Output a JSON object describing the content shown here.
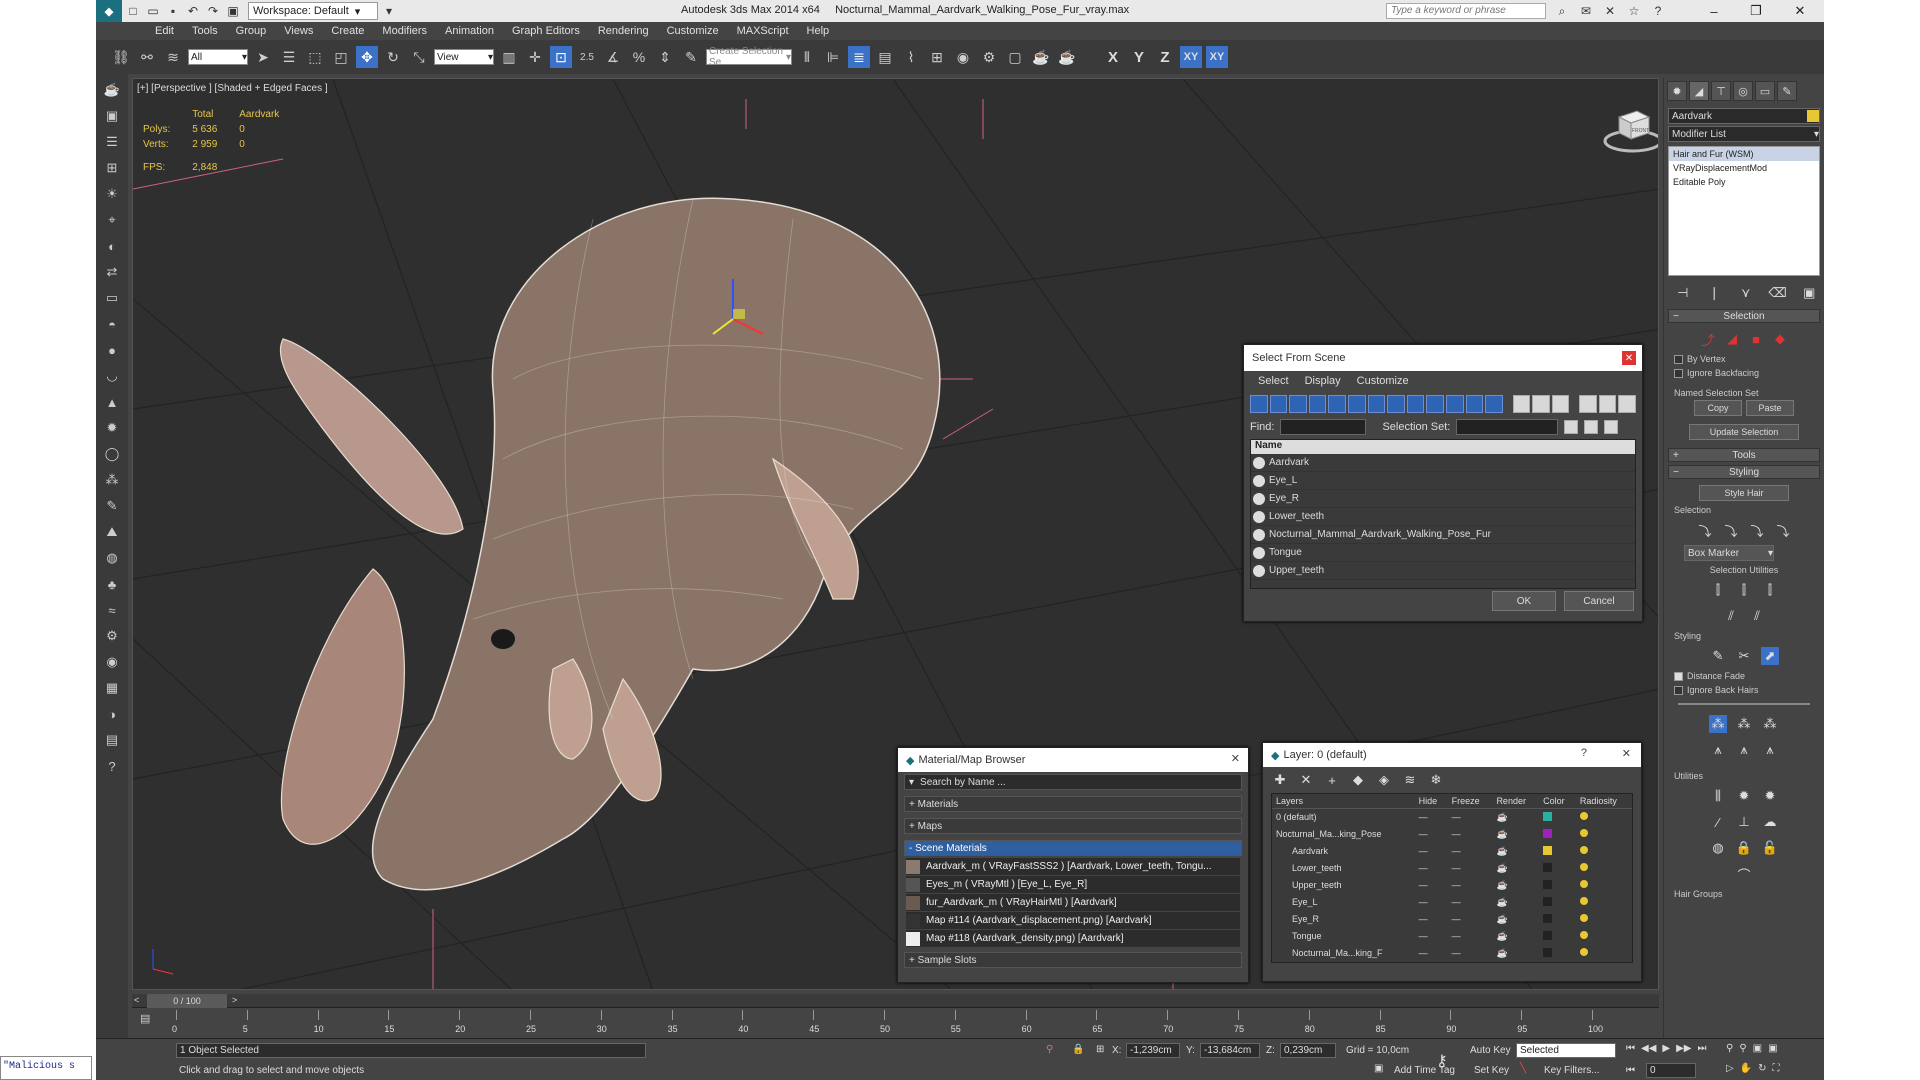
{
  "titlebar": {
    "workspace": "Workspace: Default",
    "app": "Autodesk 3ds Max  2014 x64",
    "file": "Nocturnal_Mammal_Aardvark_Walking_Pose_Fur_vray.max",
    "search_placeholder": "Type a keyword or phrase"
  },
  "menu": [
    "Edit",
    "Tools",
    "Group",
    "Views",
    "Create",
    "Modifiers",
    "Animation",
    "Graph Editors",
    "Rendering",
    "Customize",
    "MAXScript",
    "Help"
  ],
  "toolbar": {
    "filter": "All",
    "refcoord": "View",
    "snap_label": "2.5",
    "named_sel_placeholder": "Create Selection Se",
    "axes": [
      "X",
      "Y",
      "Z",
      "XY",
      "XY"
    ]
  },
  "viewport": {
    "label": "[+] [Perspective ] [Shaded + Edged Faces ]",
    "stats": {
      "col_total": "Total",
      "col_obj": "Aardvark",
      "polys_label": "Polys:",
      "polys_total": "5 636",
      "polys_obj": "0",
      "verts_label": "Verts:",
      "verts_total": "2 959",
      "verts_obj": "0",
      "fps_label": "FPS:",
      "fps": "2,848"
    },
    "viewcube_label": "FRONT"
  },
  "select_from_scene": {
    "title": "Select From Scene",
    "menu": [
      "Select",
      "Display",
      "Customize"
    ],
    "find_label": "Find:",
    "selection_set_label": "Selection Set:",
    "column_name": "Name",
    "items": [
      "Aardvark",
      "Eye_L",
      "Eye_R",
      "Lower_teeth",
      "Nocturnal_Mammal_Aardvark_Walking_Pose_Fur",
      "Tongue",
      "Upper_teeth"
    ],
    "ok": "OK",
    "cancel": "Cancel"
  },
  "material_browser": {
    "title": "Material/Map Browser",
    "search_placeholder": "Search by Name ...",
    "sections": [
      "+ Materials",
      "+ Maps",
      "- Scene Materials"
    ],
    "scene_materials": [
      "Aardvark_m  ( VRayFastSSS2 ) [Aardvark, Lower_teeth, Tongu...",
      "Eyes_m  ( VRayMtl ) [Eye_L, Eye_R]",
      "fur_Aardvark_m  ( VRayHairMtl ) [Aardvark]",
      "Map #114 (Aardvark_displacement.png) [Aardvark]",
      "Map #118 (Aardvark_density.png) [Aardvark]"
    ],
    "sample_slots": "+ Sample Slots"
  },
  "layer_dialog": {
    "title": "Layer: 0 (default)",
    "help": "?",
    "columns": [
      "Layers",
      "Hide",
      "Freeze",
      "Render",
      "Color",
      "Radiosity"
    ],
    "rows": [
      {
        "name": "0 (default)",
        "color": "#2ab0a0"
      },
      {
        "name": "Nocturnal_Ma...king_Pose",
        "color": "#a020c0"
      },
      {
        "name": "Aardvark",
        "color": "#e8c830"
      },
      {
        "name": "Lower_teeth",
        "color": "#222222"
      },
      {
        "name": "Upper_teeth",
        "color": "#222222"
      },
      {
        "name": "Eye_L",
        "color": "#222222"
      },
      {
        "name": "Eye_R",
        "color": "#222222"
      },
      {
        "name": "Tongue",
        "color": "#222222"
      },
      {
        "name": "Nocturnal_Ma...king_F",
        "color": "#222222"
      }
    ]
  },
  "command_panel": {
    "object_name": "Aardvark",
    "modifier_list": "Modifier List",
    "stack": [
      "Hair and Fur (WSM)",
      "VRayDisplacementMod",
      "Editable Poly"
    ],
    "selection_rollout": "Selection",
    "by_vertex": "By Vertex",
    "ignore_backfacing": "Ignore Backfacing",
    "named_selection_set": "Named Selection Set",
    "copy": "Copy",
    "paste": "Paste",
    "update_selection": "Update Selection",
    "tools_rollout": "Tools",
    "styling_rollout": "Styling",
    "style_hair": "Style Hair",
    "selection_sub": "Selection",
    "box_marker": "Box Marker",
    "selection_utilities": "Selection Utilities",
    "styling_sub": "Styling",
    "distance_fade": "Distance Fade",
    "ignore_back_hairs": "Ignore Back Hairs",
    "utilities": "Utilities",
    "hair_groups": "Hair Groups"
  },
  "timeline": {
    "frame": "0 / 100",
    "ticks": [
      "0",
      "5",
      "10",
      "15",
      "20",
      "25",
      "30",
      "35",
      "40",
      "45",
      "50",
      "55",
      "60",
      "65",
      "70",
      "75",
      "80",
      "85",
      "90",
      "95",
      "100"
    ]
  },
  "statusbar": {
    "selected": "1 Object Selected",
    "prompt": "Click and drag to select and move objects",
    "maxscript": "\"Malicious s",
    "x_label": "X:",
    "x": "-1,239cm",
    "y_label": "Y:",
    "y": "-13,684cm",
    "z_label": "Z:",
    "z": "0,239cm",
    "grid": "Grid = 10,0cm",
    "add_time_tag": "Add Time Tag",
    "auto_key": "Auto Key",
    "set_key": "Set Key",
    "selected_dd": "Selected",
    "key_filters": "Key Filters...",
    "frame_box": "0"
  }
}
